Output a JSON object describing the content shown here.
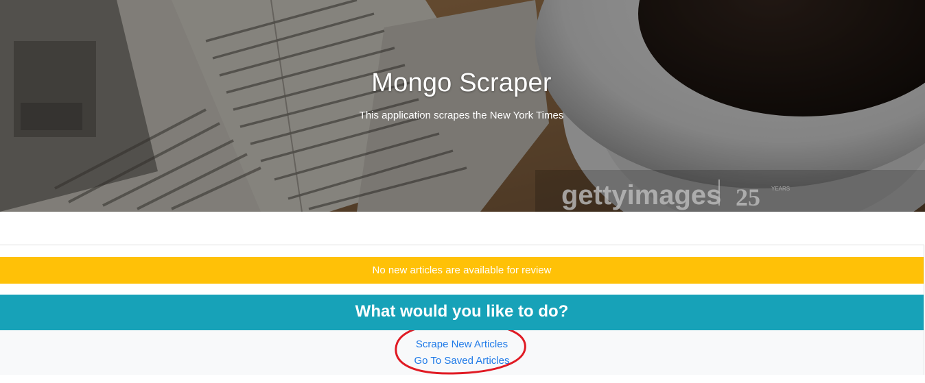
{
  "hero": {
    "title": "Mongo Scraper",
    "subtitle": "This application scrapes the New York Times",
    "watermark": "gettyimages",
    "watermark_years": "25",
    "watermark_years_label": "YEARS"
  },
  "alert": {
    "message": "No new articles are available for review",
    "color": "#ffc107"
  },
  "card": {
    "header": "What would you like to do?",
    "header_color": "#17a2b8",
    "actions": [
      {
        "label": "Scrape New Articles"
      },
      {
        "label": "Go To Saved Articles"
      }
    ]
  },
  "annotation": {
    "color": "#e01b24"
  }
}
